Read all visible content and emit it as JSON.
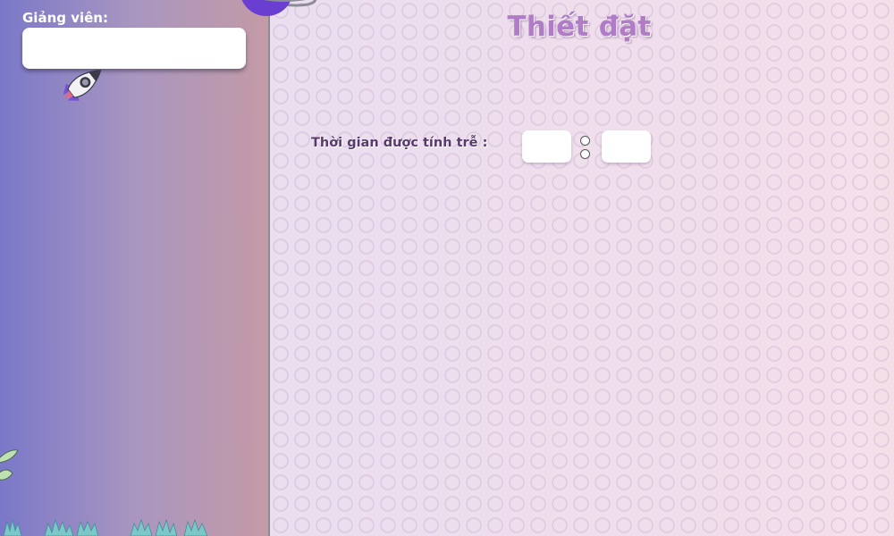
{
  "sidebar": {
    "lecturer_label": "Giảng viên:",
    "lecturer_value": ""
  },
  "main": {
    "title": "Thiết đặt",
    "late_time_label": "Thời gian được tính trễ :",
    "hours_value": "",
    "minutes_value": ""
  },
  "colors": {
    "sidebar_gradient_start": "#7a78c8",
    "sidebar_gradient_end": "#c49aa6",
    "title": "#b07cc8",
    "label": "#5a3a6e"
  }
}
